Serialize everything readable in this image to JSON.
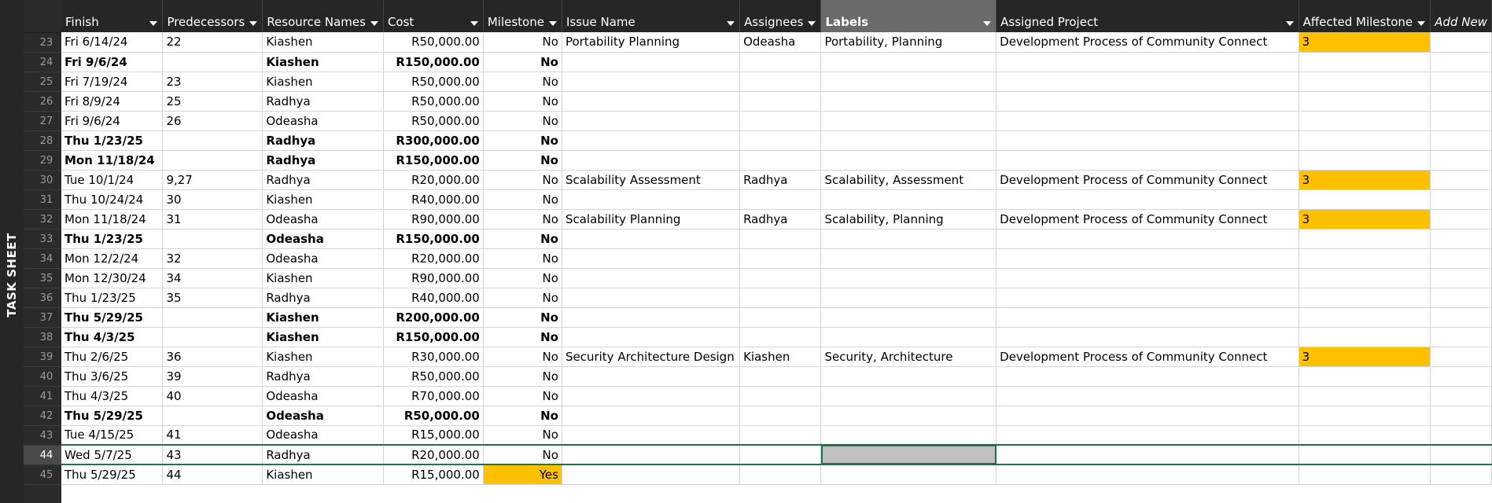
{
  "sidebar": {
    "label": "TASK SHEET"
  },
  "columns": [
    "Finish",
    "Predecessors",
    "Resource Names",
    "Cost",
    "Milestone",
    "Issue Name",
    "Assignees",
    "Labels",
    "Assigned Project",
    "Affected Milestone",
    "Add New"
  ],
  "active_column": "Labels",
  "selected_row": "44",
  "colors": {
    "highlight": "#ffc000",
    "header_bg": "#262626",
    "active_header": "#6a6a6a",
    "selection": "#217346"
  },
  "rows": [
    {
      "id": "23",
      "finish": "Fri 6/14/24",
      "pred": "22",
      "res": "Kiashen",
      "cost": "R50,000.00",
      "ms": "No",
      "issue": "Portability Planning",
      "assignees": "Odeasha",
      "labels": "Portability, Planning",
      "project": "Development Process of Community Connect",
      "affected": "3"
    },
    {
      "id": "24",
      "finish": "Fri 9/6/24",
      "pred": "",
      "res": "Kiashen",
      "cost": "R150,000.00",
      "ms": "No",
      "summary": true
    },
    {
      "id": "25",
      "finish": "Fri 7/19/24",
      "pred": "23",
      "res": "Kiashen",
      "cost": "R50,000.00",
      "ms": "No"
    },
    {
      "id": "26",
      "finish": "Fri 8/9/24",
      "pred": "25",
      "res": "Radhya",
      "cost": "R50,000.00",
      "ms": "No"
    },
    {
      "id": "27",
      "finish": "Fri 9/6/24",
      "pred": "26",
      "res": "Odeasha",
      "cost": "R50,000.00",
      "ms": "No"
    },
    {
      "id": "28",
      "finish": "Thu 1/23/25",
      "pred": "",
      "res": "Radhya",
      "cost": "R300,000.00",
      "ms": "No",
      "summary": true
    },
    {
      "id": "29",
      "finish": "Mon 11/18/24",
      "pred": "",
      "res": "Radhya",
      "cost": "R150,000.00",
      "ms": "No",
      "summary": true
    },
    {
      "id": "30",
      "finish": "Tue 10/1/24",
      "pred": "9,27",
      "res": "Radhya",
      "cost": "R20,000.00",
      "ms": "No",
      "issue": "Scalability Assessment",
      "assignees": "Radhya",
      "labels": "Scalability, Assessment",
      "project": "Development Process of Community Connect",
      "affected": "3"
    },
    {
      "id": "31",
      "finish": "Thu 10/24/24",
      "pred": "30",
      "res": "Kiashen",
      "cost": "R40,000.00",
      "ms": "No"
    },
    {
      "id": "32",
      "finish": "Mon 11/18/24",
      "pred": "31",
      "res": "Odeasha",
      "cost": "R90,000.00",
      "ms": "No",
      "issue": "Scalability Planning",
      "assignees": "Radhya",
      "labels": "Scalability, Planning",
      "project": "Development Process of Community Connect",
      "affected": "3"
    },
    {
      "id": "33",
      "finish": "Thu 1/23/25",
      "pred": "",
      "res": "Odeasha",
      "cost": "R150,000.00",
      "ms": "No",
      "summary": true
    },
    {
      "id": "34",
      "finish": "Mon 12/2/24",
      "pred": "32",
      "res": "Odeasha",
      "cost": "R20,000.00",
      "ms": "No"
    },
    {
      "id": "35",
      "finish": "Mon 12/30/24",
      "pred": "34",
      "res": "Kiashen",
      "cost": "R90,000.00",
      "ms": "No"
    },
    {
      "id": "36",
      "finish": "Thu 1/23/25",
      "pred": "35",
      "res": "Radhya",
      "cost": "R40,000.00",
      "ms": "No"
    },
    {
      "id": "37",
      "finish": "Thu 5/29/25",
      "pred": "",
      "res": "Kiashen",
      "cost": "R200,000.00",
      "ms": "No",
      "summary": true
    },
    {
      "id": "38",
      "finish": "Thu 4/3/25",
      "pred": "",
      "res": "Kiashen",
      "cost": "R150,000.00",
      "ms": "No",
      "summary": true
    },
    {
      "id": "39",
      "finish": "Thu 2/6/25",
      "pred": "36",
      "res": "Kiashen",
      "cost": "R30,000.00",
      "ms": "No",
      "issue": "Security Architecture Design",
      "assignees": "Kiashen",
      "labels": "Security, Architecture",
      "project": "Development Process of Community Connect",
      "affected": "3"
    },
    {
      "id": "40",
      "finish": "Thu 3/6/25",
      "pred": "39",
      "res": "Radhya",
      "cost": "R50,000.00",
      "ms": "No"
    },
    {
      "id": "41",
      "finish": "Thu 4/3/25",
      "pred": "40",
      "res": "Odeasha",
      "cost": "R70,000.00",
      "ms": "No"
    },
    {
      "id": "42",
      "finish": "Thu 5/29/25",
      "pred": "",
      "res": "Odeasha",
      "cost": "R50,000.00",
      "ms": "No",
      "summary": true
    },
    {
      "id": "43",
      "finish": "Tue 4/15/25",
      "pred": "41",
      "res": "Odeasha",
      "cost": "R15,000.00",
      "ms": "No"
    },
    {
      "id": "44",
      "finish": "Wed 5/7/25",
      "pred": "43",
      "res": "Radhya",
      "cost": "R20,000.00",
      "ms": "No"
    },
    {
      "id": "45",
      "finish": "Thu 5/29/25",
      "pred": "44",
      "res": "Kiashen",
      "cost": "R15,000.00",
      "ms": "Yes",
      "ms_highlight": true
    }
  ]
}
